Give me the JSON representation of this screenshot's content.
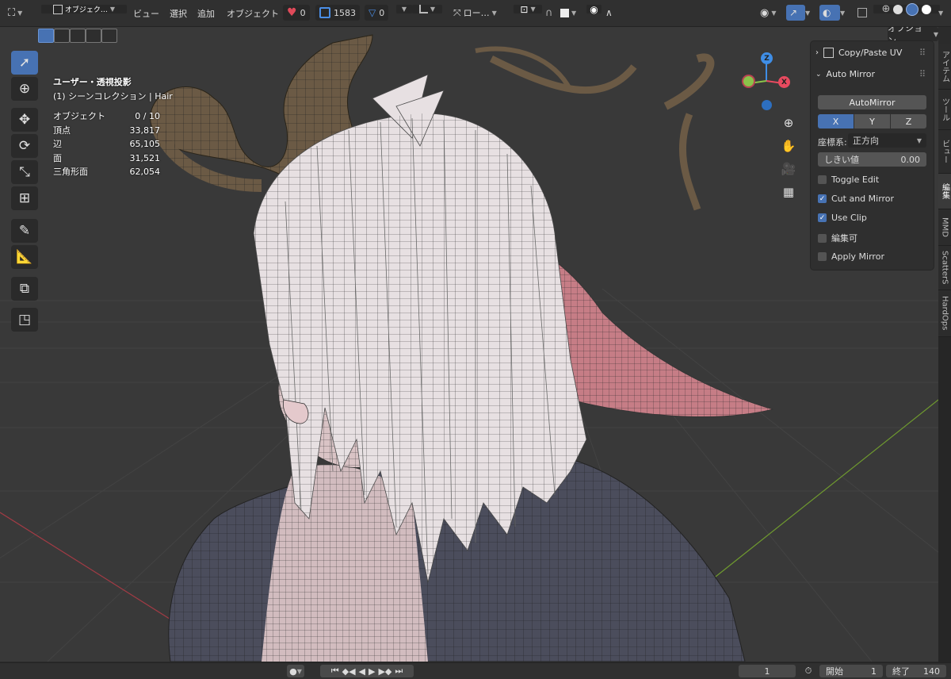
{
  "header": {
    "editor_icon": "editor-type-icon",
    "mode_label": "オブジェク…",
    "menus": [
      "ビュー",
      "選択",
      "追加",
      "オブジェクト"
    ],
    "heart_count": "0",
    "vertex_count": "1583",
    "triangle_count": "0",
    "orientation_label": "ロー…",
    "options_label": "オプション"
  },
  "viewport": {
    "view_name": "ユーザー・透視投影",
    "collection_label": "(1) シーンコレクション | Hair",
    "stats": [
      {
        "label": "オブジェクト",
        "value": "0 / 10"
      },
      {
        "label": "頂点",
        "value": "33,817"
      },
      {
        "label": "辺",
        "value": "65,105"
      },
      {
        "label": "面",
        "value": "31,521"
      },
      {
        "label": "三角形面",
        "value": "62,054"
      }
    ],
    "gizmo": {
      "z": "Z",
      "x": "X"
    }
  },
  "npanel": {
    "copy_paste_title": "Copy/Paste UV",
    "auto_mirror_title": "Auto Mirror",
    "auto_mirror_button": "AutoMirror",
    "axes": [
      "X",
      "Y",
      "Z"
    ],
    "coord_label": "座標系:",
    "coord_value": "正方向",
    "threshold_label": "しきい値",
    "threshold_value": "0.00",
    "checks": [
      {
        "label": "Toggle Edit",
        "checked": false
      },
      {
        "label": "Cut and Mirror",
        "checked": true
      },
      {
        "label": "Use Clip",
        "checked": true
      },
      {
        "label": "編集可",
        "checked": false
      },
      {
        "label": "Apply Mirror",
        "checked": false
      }
    ]
  },
  "sidetabs": [
    "アイテム",
    "ツール",
    "ビュー",
    "編集",
    "MMD",
    "ScatterS",
    "HardOps"
  ],
  "timeline": {
    "current_frame": "1",
    "start_label": "開始",
    "start_value": "1",
    "end_label": "終了",
    "end_value": "140"
  },
  "colors": {
    "accent": "#4772b3",
    "viewport_bg": "#393939",
    "header_bg": "#303030",
    "axis_x": "#e84a5f",
    "axis_y": "#8bc34a",
    "axis_z": "#3f8ee6"
  }
}
